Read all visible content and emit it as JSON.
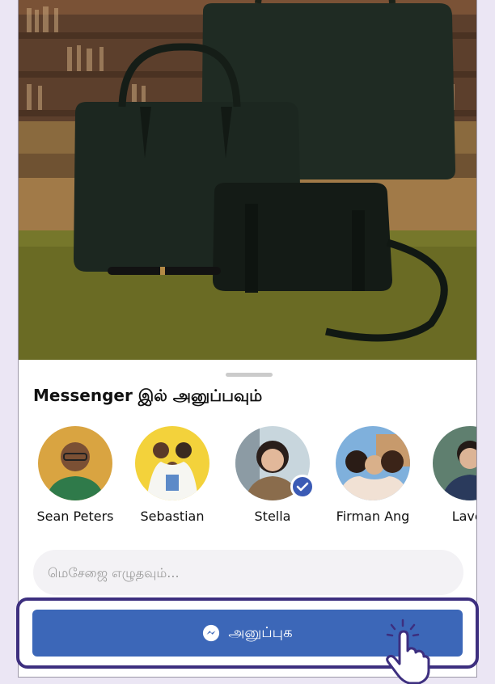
{
  "sheet": {
    "title": "Messenger இல் அனுப்பவும்"
  },
  "contacts": [
    {
      "name": "Sean Peters",
      "selected": false
    },
    {
      "name": "Sebastian",
      "selected": false
    },
    {
      "name": "Stella",
      "selected": true
    },
    {
      "name": "Firman Ang",
      "selected": false
    },
    {
      "name": "Laver",
      "selected": false
    }
  ],
  "message": {
    "placeholder": "மெசேஜை எழுதவும்..."
  },
  "send_button": {
    "label": "அனுப்புக",
    "icon": "messenger-icon"
  },
  "colors": {
    "accent": "#3c67b8",
    "highlight": "#3d2f7f",
    "background": "#ebe6f4",
    "check": "#3b5bb5"
  }
}
